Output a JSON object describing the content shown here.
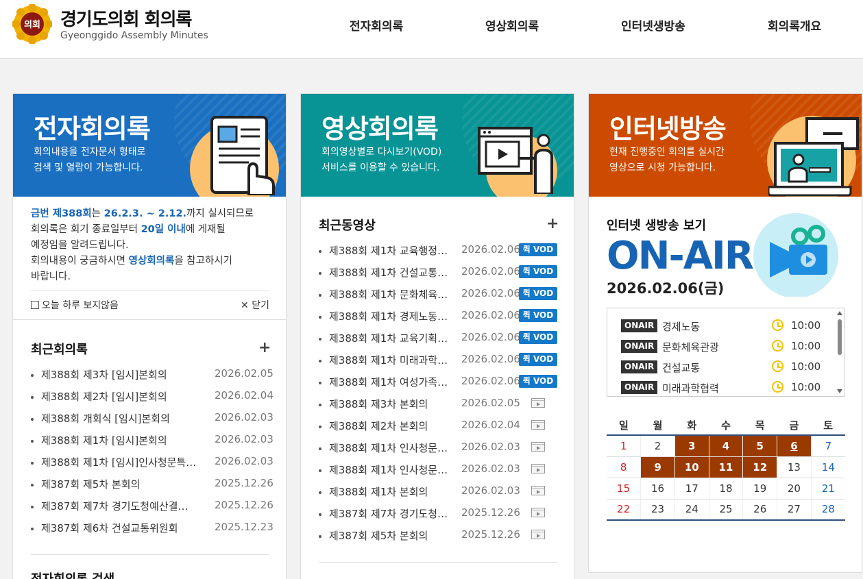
{
  "header": {
    "emblem_text": "의회",
    "title": "경기도의회 회의록",
    "subtitle": "Gyeonggido  Assembly Minutes",
    "nav": [
      "전자회의록",
      "영상회의록",
      "인터넷생방송",
      "회의록개요"
    ]
  },
  "colors": {
    "blue_banner": "#1a6fc1",
    "teal_banner": "#089395",
    "orange_banner": "#cc4b00",
    "link_blue": "#1864b4",
    "calendar_active": "#9b3a00",
    "vod_badge": "#1479c8"
  },
  "cards": {
    "minutes": {
      "banner_title": "전자회의록",
      "banner_desc": [
        "회의내용을 전자문서 형태로",
        "검색 및 열람이 가능합니다."
      ],
      "notice": {
        "l1a": "금번 제388회",
        "l1b": "는 ",
        "l1c": "26.2.3. ~ 2.12.",
        "l1d": "까지 실시되므로",
        "l2a": "회의록은 회기 종료일부터 ",
        "l2b": "20일 이내",
        "l2c": "에 게재될",
        "l3": "예정임을 알려드립니다.",
        "l4a": "회의내용이 궁금하시면 ",
        "l4b": "영상회의록",
        "l4c": "을 참고하시기",
        "l5": "바랍니다."
      },
      "no_show_today": "오늘 하루 보지않음",
      "close_label": "닫기",
      "recent_title": "최근회의록",
      "recent": [
        {
          "title": "제388회 제3차 [임시]본회의",
          "date": "2026.02.05"
        },
        {
          "title": "제388회 제2차 [임시]본회의",
          "date": "2026.02.04"
        },
        {
          "title": "제388회 개회식 [임시]본회의",
          "date": "2026.02.03"
        },
        {
          "title": "제388회 제1차 [임시]본회의",
          "date": "2026.02.03"
        },
        {
          "title": "제388회 제1차 [임시]인사청문특…",
          "date": "2026.02.03"
        },
        {
          "title": "제387회 제5차 본회의",
          "date": "2025.12.26"
        },
        {
          "title": "제387회 제7차 경기도청예산결…",
          "date": "2025.12.26"
        },
        {
          "title": "제387회 제6차 건설교통위원회",
          "date": "2025.12.23"
        }
      ],
      "search_title": "전자회의록 검색"
    },
    "video": {
      "banner_title": "영상회의록",
      "banner_desc": [
        "회의영상별로 다시보기(VOD)",
        "서비스를 이용할 수 있습니다."
      ],
      "recent_title": "최근동영상",
      "vod_label": "퀵 VOD",
      "recent": [
        {
          "title": "제388회 제1차 교육행정…",
          "date": "2026.02.06",
          "vod": true
        },
        {
          "title": "제388회 제1차 건설교통…",
          "date": "2026.02.06",
          "vod": true
        },
        {
          "title": "제388회 제1차 문화체육…",
          "date": "2026.02.06",
          "vod": true
        },
        {
          "title": "제388회 제1차 경제노동…",
          "date": "2026.02.06",
          "vod": true
        },
        {
          "title": "제388회 제1차 교육기획…",
          "date": "2026.02.06",
          "vod": true
        },
        {
          "title": "제388회 제1차 미래과학…",
          "date": "2026.02.06",
          "vod": true
        },
        {
          "title": "제388회 제1차 여성가족…",
          "date": "2026.02.06",
          "vod": true
        },
        {
          "title": "제388회 제3차 본회의",
          "date": "2026.02.05",
          "vod": false
        },
        {
          "title": "제388회 제2차 본회의",
          "date": "2026.02.04",
          "vod": false
        },
        {
          "title": "제388회 제1차 인사청문…",
          "date": "2026.02.03",
          "vod": false
        },
        {
          "title": "제388회 제1차 인사청문…",
          "date": "2026.02.03",
          "vod": false
        },
        {
          "title": "제388회 제1차 본회의",
          "date": "2026.02.03",
          "vod": false
        },
        {
          "title": "제387회 제7차 경기도청…",
          "date": "2025.12.26",
          "vod": false
        },
        {
          "title": "제387회 제5차 본회의",
          "date": "2025.12.26",
          "vod": false
        }
      ]
    },
    "broadcast": {
      "banner_title": "인터넷방송",
      "banner_desc": [
        "현재 진행중인 회의를 실시간",
        "영상으로 시청 가능합니다."
      ],
      "live_title": "인터넷 생방송 보기",
      "onair_big": "ON-AIR",
      "date": "2026.02.06(금)",
      "onair_tag": "ONAIR",
      "schedule": [
        {
          "name": "경제노동",
          "time": "10:00"
        },
        {
          "name": "문화체육관광",
          "time": "10:00"
        },
        {
          "name": "건설교통",
          "time": "10:00"
        },
        {
          "name": "미래과학협력",
          "time": "10:00"
        }
      ],
      "calendar": {
        "weekdays": [
          "일",
          "월",
          "화",
          "수",
          "목",
          "금",
          "토"
        ],
        "weeks": [
          [
            "1",
            "2",
            "3",
            "4",
            "5",
            "6",
            "7"
          ],
          [
            "8",
            "9",
            "10",
            "11",
            "12",
            "13",
            "14"
          ],
          [
            "15",
            "16",
            "17",
            "18",
            "19",
            "20",
            "21"
          ],
          [
            "22",
            "23",
            "24",
            "25",
            "26",
            "27",
            "28"
          ]
        ],
        "session_days": [
          "3",
          "4",
          "5",
          "6",
          "9",
          "10",
          "11",
          "12"
        ],
        "today": "6"
      }
    }
  }
}
